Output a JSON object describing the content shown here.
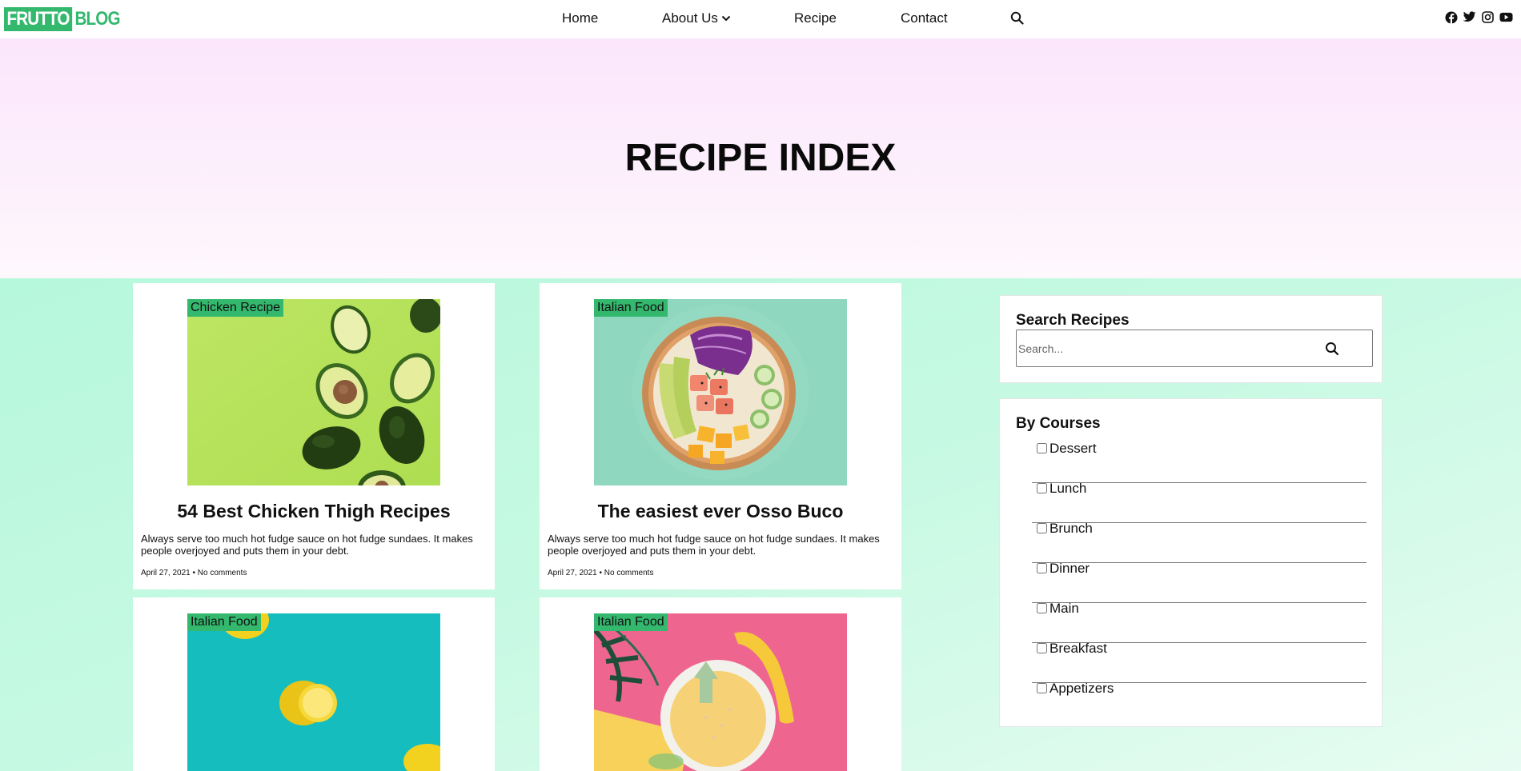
{
  "logo": {
    "box_text": "FRUTTO",
    "rest_text": "BLOG",
    "brand_color": "#33b86e"
  },
  "nav": {
    "items": [
      {
        "label": "Home"
      },
      {
        "label": "About Us",
        "has_dropdown": true
      },
      {
        "label": "Recipe"
      },
      {
        "label": "Contact"
      }
    ],
    "search_icon": "search-icon"
  },
  "social": [
    "facebook-icon",
    "twitter-icon",
    "instagram-icon",
    "youtube-icon"
  ],
  "hero": {
    "title": "RECIPE INDEX"
  },
  "cards": [
    {
      "tag": "Chicken Recipe",
      "title": "54 Best Chicken Thigh Recipes",
      "excerpt": "Always serve too much hot fudge sauce on hot fudge sundaes. It makes people overjoyed and puts them in your debt.",
      "meta": "April 27, 2021 • No comments",
      "image": "avocados on green background"
    },
    {
      "tag": "Italian Food",
      "title": "The easiest ever Osso Buco",
      "excerpt": "Always serve too much hot fudge sauce on hot fudge sundaes. It makes people overjoyed and puts them in your debt.",
      "meta": "April 27, 2021 • No comments",
      "image": "poke bowl on mint background"
    },
    {
      "tag": "Italian Food",
      "image": "lemons on teal background"
    },
    {
      "tag": "Italian Food",
      "image": "banana and smoothie bowl on pink and yellow background"
    }
  ],
  "sidebar": {
    "search": {
      "title": "Search Recipes",
      "placeholder": "Search..."
    },
    "courses": {
      "title": "By Courses",
      "items": [
        "Dessert",
        "Lunch",
        "Brunch",
        "Dinner",
        "Main",
        "Breakfast",
        "Appetizers"
      ]
    }
  }
}
